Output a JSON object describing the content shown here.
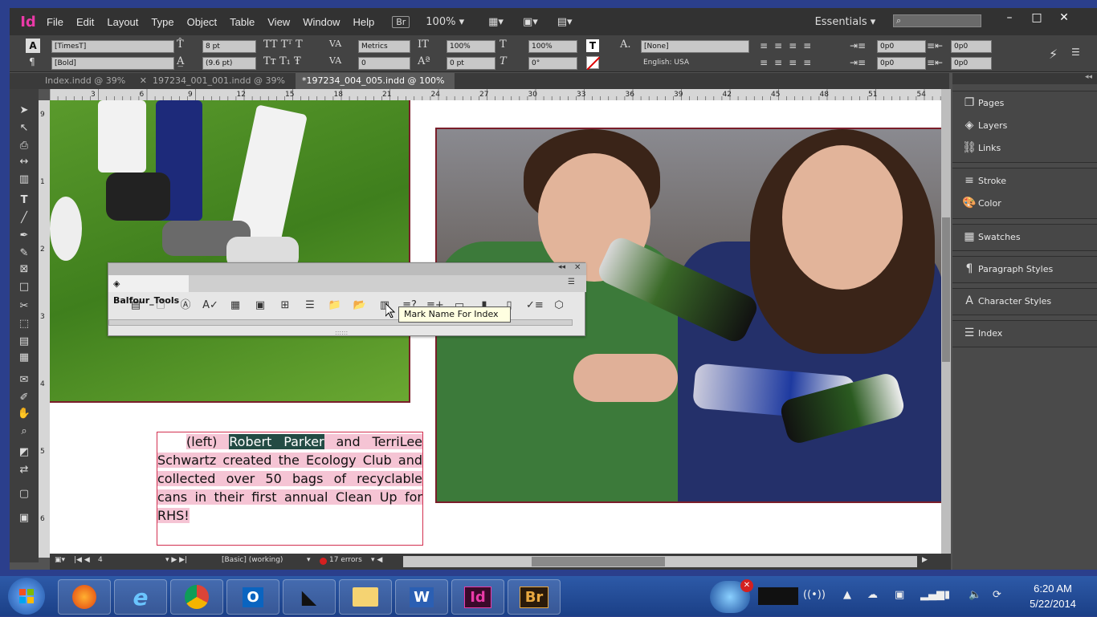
{
  "app": {
    "logo": "Id",
    "menu": [
      "File",
      "Edit",
      "Layout",
      "Type",
      "Object",
      "Table",
      "View",
      "Window",
      "Help"
    ],
    "bridge_label": "Br",
    "zoom": "100%",
    "workspace": "Essentials",
    "search_placeholder": ""
  },
  "control_panel": {
    "font_family": "[TimesT]",
    "font_style": "[Bold]",
    "font_size": "8 pt",
    "leading": "(9.6 pt)",
    "kerning": "Metrics",
    "tracking": "0",
    "vscale": "100%",
    "hscale": "100%",
    "baseline": "0 pt",
    "skew": "0°",
    "char_style": "[None]",
    "language": "English: USA",
    "indent1": "0p0",
    "indent2": "0p0",
    "indent3": "0p0",
    "indent4": "0p0"
  },
  "tabs": [
    {
      "label": "Index.indd @ 39%"
    },
    {
      "label": "197234_001_001.indd @ 39%"
    },
    {
      "label": "*197234_004_005.indd @ 100%"
    }
  ],
  "ruler_ticks": [
    "3",
    "6",
    "9",
    "12",
    "15",
    "18",
    "21",
    "24",
    "27",
    "30",
    "33",
    "36",
    "39",
    "42",
    "45",
    "48",
    "51",
    "54"
  ],
  "vruler_ticks": [
    "9",
    "1",
    "2",
    "3",
    "4",
    "5",
    "6"
  ],
  "panels": [
    {
      "label": "Pages"
    },
    {
      "label": "Layers"
    },
    {
      "label": "Links"
    },
    {
      "label": "Stroke"
    },
    {
      "label": "Color"
    },
    {
      "label": "Swatches"
    },
    {
      "label": "Paragraph Styles"
    },
    {
      "label": "Character Styles"
    },
    {
      "label": "Index"
    }
  ],
  "balfour": {
    "title": "Balfour_Tools",
    "tooltip": "Mark Name For Index"
  },
  "caption": {
    "prefix": "(left) ",
    "selected": "Robert Parker",
    "rest": " and TerriLee Schwartz created the Ecology Club and collected over 50 bags of recyclable cans in their first annual Clean Up for RHS!"
  },
  "status": {
    "page": "4",
    "style": "[Basic] (working)",
    "errors": "17 errors"
  },
  "taskbar": {
    "time": "6:20 AM",
    "date": "5/22/2014",
    "apps": [
      "Start",
      "Firefox",
      "Internet Explorer",
      "Chrome",
      "Outlook",
      "Notebook",
      "Explorer",
      "Word",
      "Id",
      "Br"
    ]
  },
  "colors": {
    "indesign_pink": "#ea3aa8",
    "frame_red": "#d23050",
    "selection": "#234b44",
    "highlight": "#f5c4d4"
  }
}
